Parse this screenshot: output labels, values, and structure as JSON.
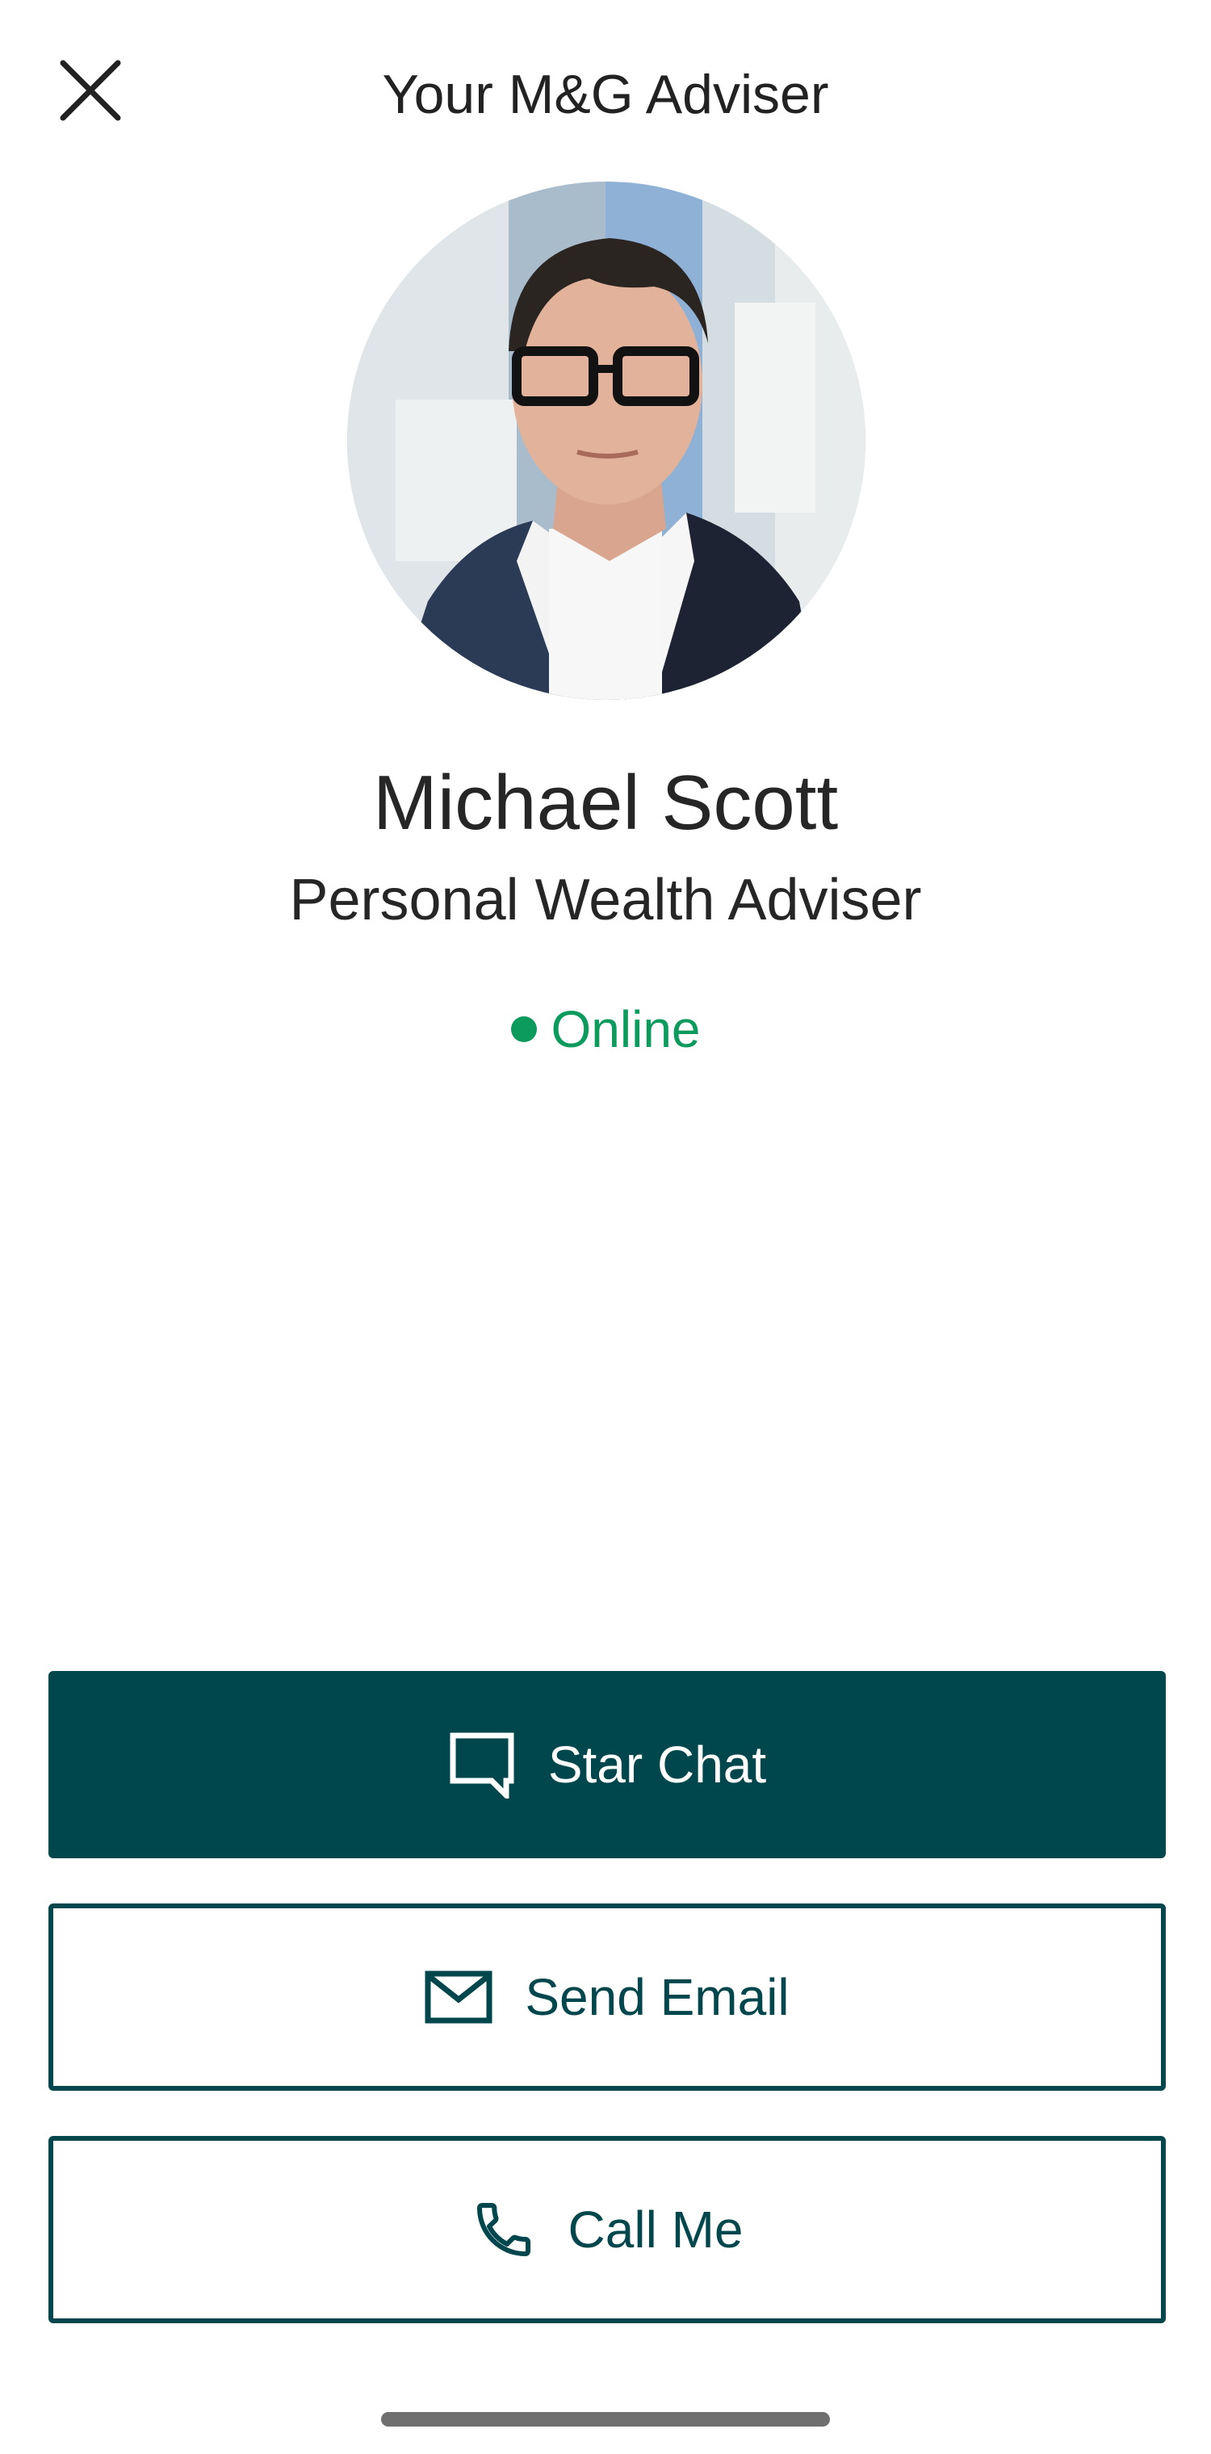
{
  "header": {
    "title": "Your M&G Adviser",
    "close_icon": "close-icon"
  },
  "adviser": {
    "name": "Michael Scott",
    "role": "Personal Wealth Adviser",
    "status": "Online",
    "status_color": "#0d9a5d"
  },
  "actions": {
    "chat": {
      "label": "Star Chat",
      "icon": "chat-bubble-icon"
    },
    "email": {
      "label": "Send Email",
      "icon": "mail-icon"
    },
    "call": {
      "label": "Call Me",
      "icon": "phone-icon"
    }
  },
  "colors": {
    "brand": "#00464d",
    "text": "#222222",
    "online": "#0d9a5d"
  }
}
